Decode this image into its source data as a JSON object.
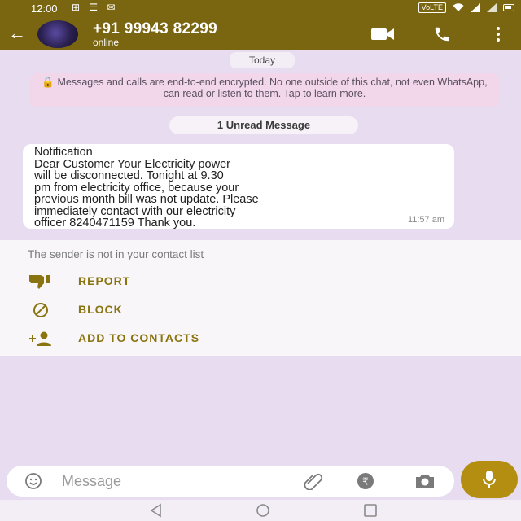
{
  "status_bar": {
    "time": "12:00",
    "left_icons": "⊞ ☰ ✉",
    "network_badge": "VoLTE",
    "right_icons": [
      "wifi-icon",
      "signal-icon",
      "battery-icon"
    ]
  },
  "header": {
    "contact_name": "+91 99943 82299",
    "contact_status": "online",
    "icons": [
      "back-arrow-icon",
      "video-call-icon",
      "voice-call-icon",
      "more-vert-icon"
    ]
  },
  "chat": {
    "date_label": "Today",
    "encryption_notice": "🔒 Messages and calls are end-to-end encrypted. No one outside of this chat, not even WhatsApp, can read or listen to them. Tap to learn more.",
    "unread_label": "1 Unread Message",
    "message": {
      "text": "Notification\nDear Customer Your Electricity power\nwill be disconnected. Tonight at 9.30\npm from electricity office, because your\nprevious month bill was not update. Please\nimmediately contact with our electricity\nofficer 8240471159 Thank you.",
      "time": "11:57 am"
    }
  },
  "unknown_sender": {
    "notice": "The sender is not in your contact list",
    "actions": [
      {
        "label": "REPORT",
        "icon": "thumbs-down-icon"
      },
      {
        "label": "BLOCK",
        "icon": "block-icon"
      },
      {
        "label": "ADD TO CONTACTS",
        "icon": "add-contact-icon"
      }
    ]
  },
  "composer": {
    "placeholder": "Message",
    "icons": [
      "emoji-icon",
      "attach-icon",
      "payment-icon",
      "camera-icon",
      "mic-icon"
    ]
  },
  "colors": {
    "header_bg": "#7a6510",
    "accent": "#b48e10",
    "chat_bg": "#e8dcf0",
    "notice_bg": "#f2d7ea",
    "action_text": "#8a7410"
  }
}
